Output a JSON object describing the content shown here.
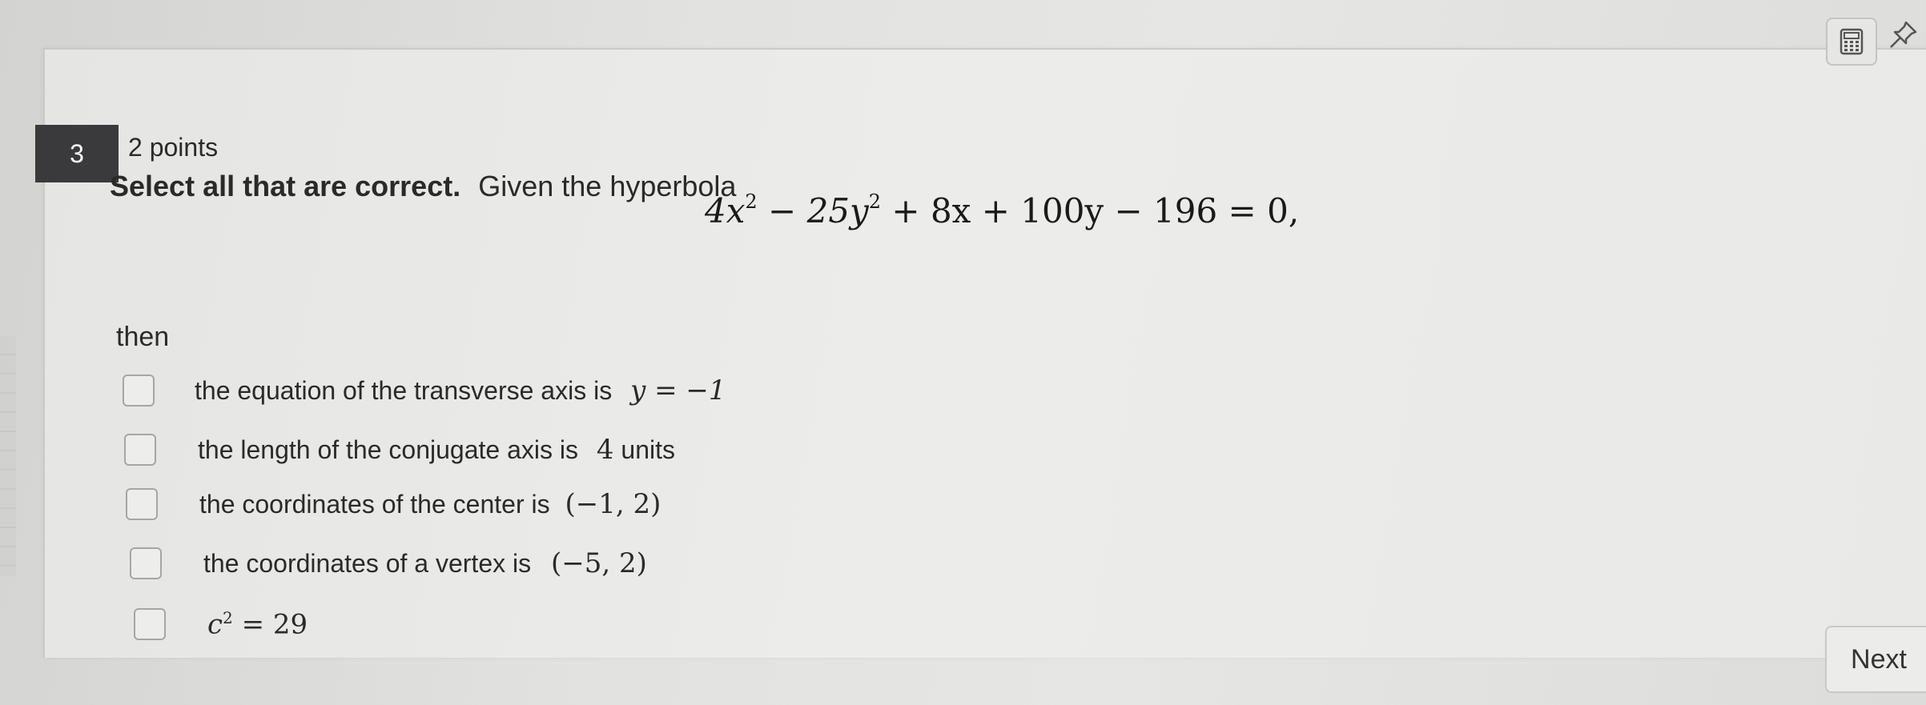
{
  "question": {
    "number": "3",
    "points": "2 points",
    "prompt_bold": "Select all that are correct.",
    "prompt_rest": "Given the hyperbola",
    "equation": {
      "t1": "4x",
      "e1": "2",
      "t2": " − 25y",
      "e2": "2",
      "t3": " + 8x + 100y − 196 = 0,"
    },
    "then": "then",
    "options": [
      {
        "text": "the equation of the transverse axis is",
        "math": "y = −1",
        "checked": false
      },
      {
        "text": "the length of the conjugate axis is",
        "math": "4",
        "suffix": "units",
        "checked": false
      },
      {
        "text": "the coordinates of the center is",
        "math": "(−1, 2)",
        "checked": false
      },
      {
        "text": "the coordinates of a vertex is",
        "math": "(−5, 2)",
        "checked": false
      },
      {
        "text": "",
        "math_base": "c",
        "math_exp": "2",
        "math_rest": " = 29",
        "checked": false
      }
    ]
  },
  "toolbar": {
    "calculator_icon": "calculator-icon",
    "pin_icon": "pin-icon"
  },
  "nav": {
    "next_label": "Next"
  }
}
